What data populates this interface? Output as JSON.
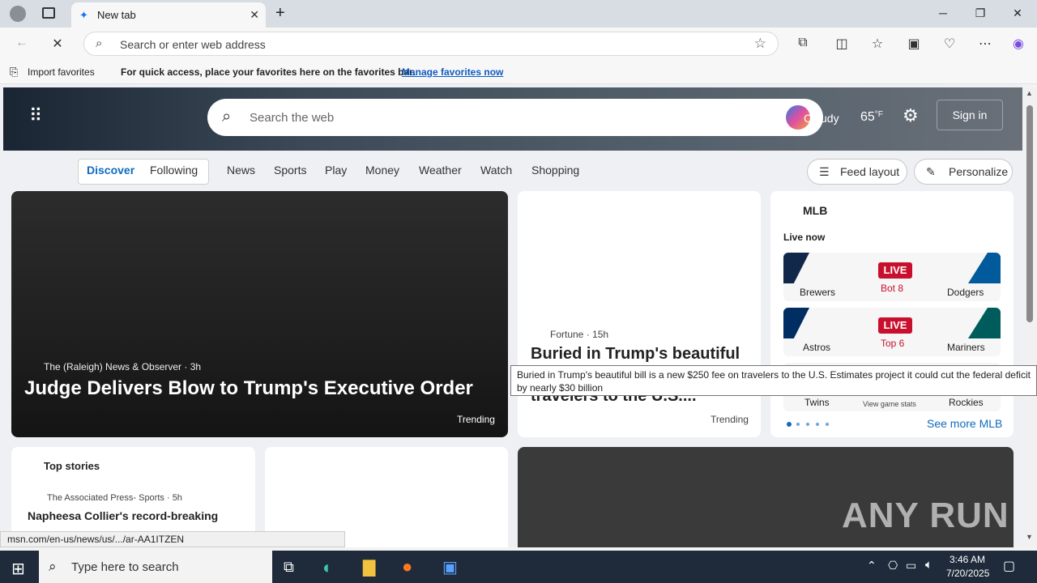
{
  "browser": {
    "tab_title": "New tab",
    "address_placeholder": "Search or enter web address",
    "favorites_bar": {
      "import_label": "Import favorites",
      "message": "For quick access, place your favorites here on the favorites bar.",
      "manage_link": "Manage favorites now"
    },
    "status_url": "msn.com/en-us/news/us/.../ar-AA1ITZEN"
  },
  "msn": {
    "search_placeholder": "Search the web",
    "weather_temp": "65",
    "weather_unit": "°F",
    "weather_label": "Cloudy",
    "sign_in": "Sign in",
    "nav": {
      "discover": "Discover",
      "following": "Following",
      "items": [
        "News",
        "Sports",
        "Play",
        "Money",
        "Weather",
        "Watch",
        "Shopping"
      ],
      "feed_layout": "Feed layout",
      "personalize": "Personalize"
    },
    "hero_story": {
      "source": "The (Raleigh) News & Observer",
      "age": "3h",
      "headline": "Judge Delivers Blow to Trump's Executive Order",
      "badge": "Trending"
    },
    "mid_story": {
      "source": "Fortune",
      "age": "15h",
      "headline_line1": "Buried in Trump's beautiful",
      "headline_line3": "travelers to the U.S....",
      "badge": "Trending",
      "tooltip": "Buried in Trump's beautiful bill is a new $250 fee on travelers to the U.S. Estimates project it could cut the federal deficit by nearly $30 billion"
    },
    "mlb": {
      "title": "MLB",
      "live_now": "Live now",
      "games": [
        {
          "home": "Brewers",
          "away": "Dodgers",
          "status": "LIVE",
          "inning": "Bot 8",
          "home_color": "#12284b",
          "away_color": "#005a9c"
        },
        {
          "home": "Astros",
          "away": "Mariners",
          "status": "LIVE",
          "inning": "Top 6",
          "home_color": "#002d62",
          "away_color": "#005c5c"
        },
        {
          "home": "Twins",
          "away": "Rockies",
          "status": "",
          "inning": "View game stats",
          "home_color": "#002b5c",
          "away_color": "#33006f"
        }
      ],
      "see_more": "See more MLB"
    },
    "top_stories": {
      "title": "Top stories",
      "source": "The Associated Press- Sports",
      "age": "5h",
      "headline": "Napheesa Collier's record-breaking"
    }
  },
  "taskbar": {
    "search_placeholder": "Type here to search",
    "time": "3:46 AM",
    "date": "7/20/2025"
  },
  "watermark": "ANY RUN"
}
